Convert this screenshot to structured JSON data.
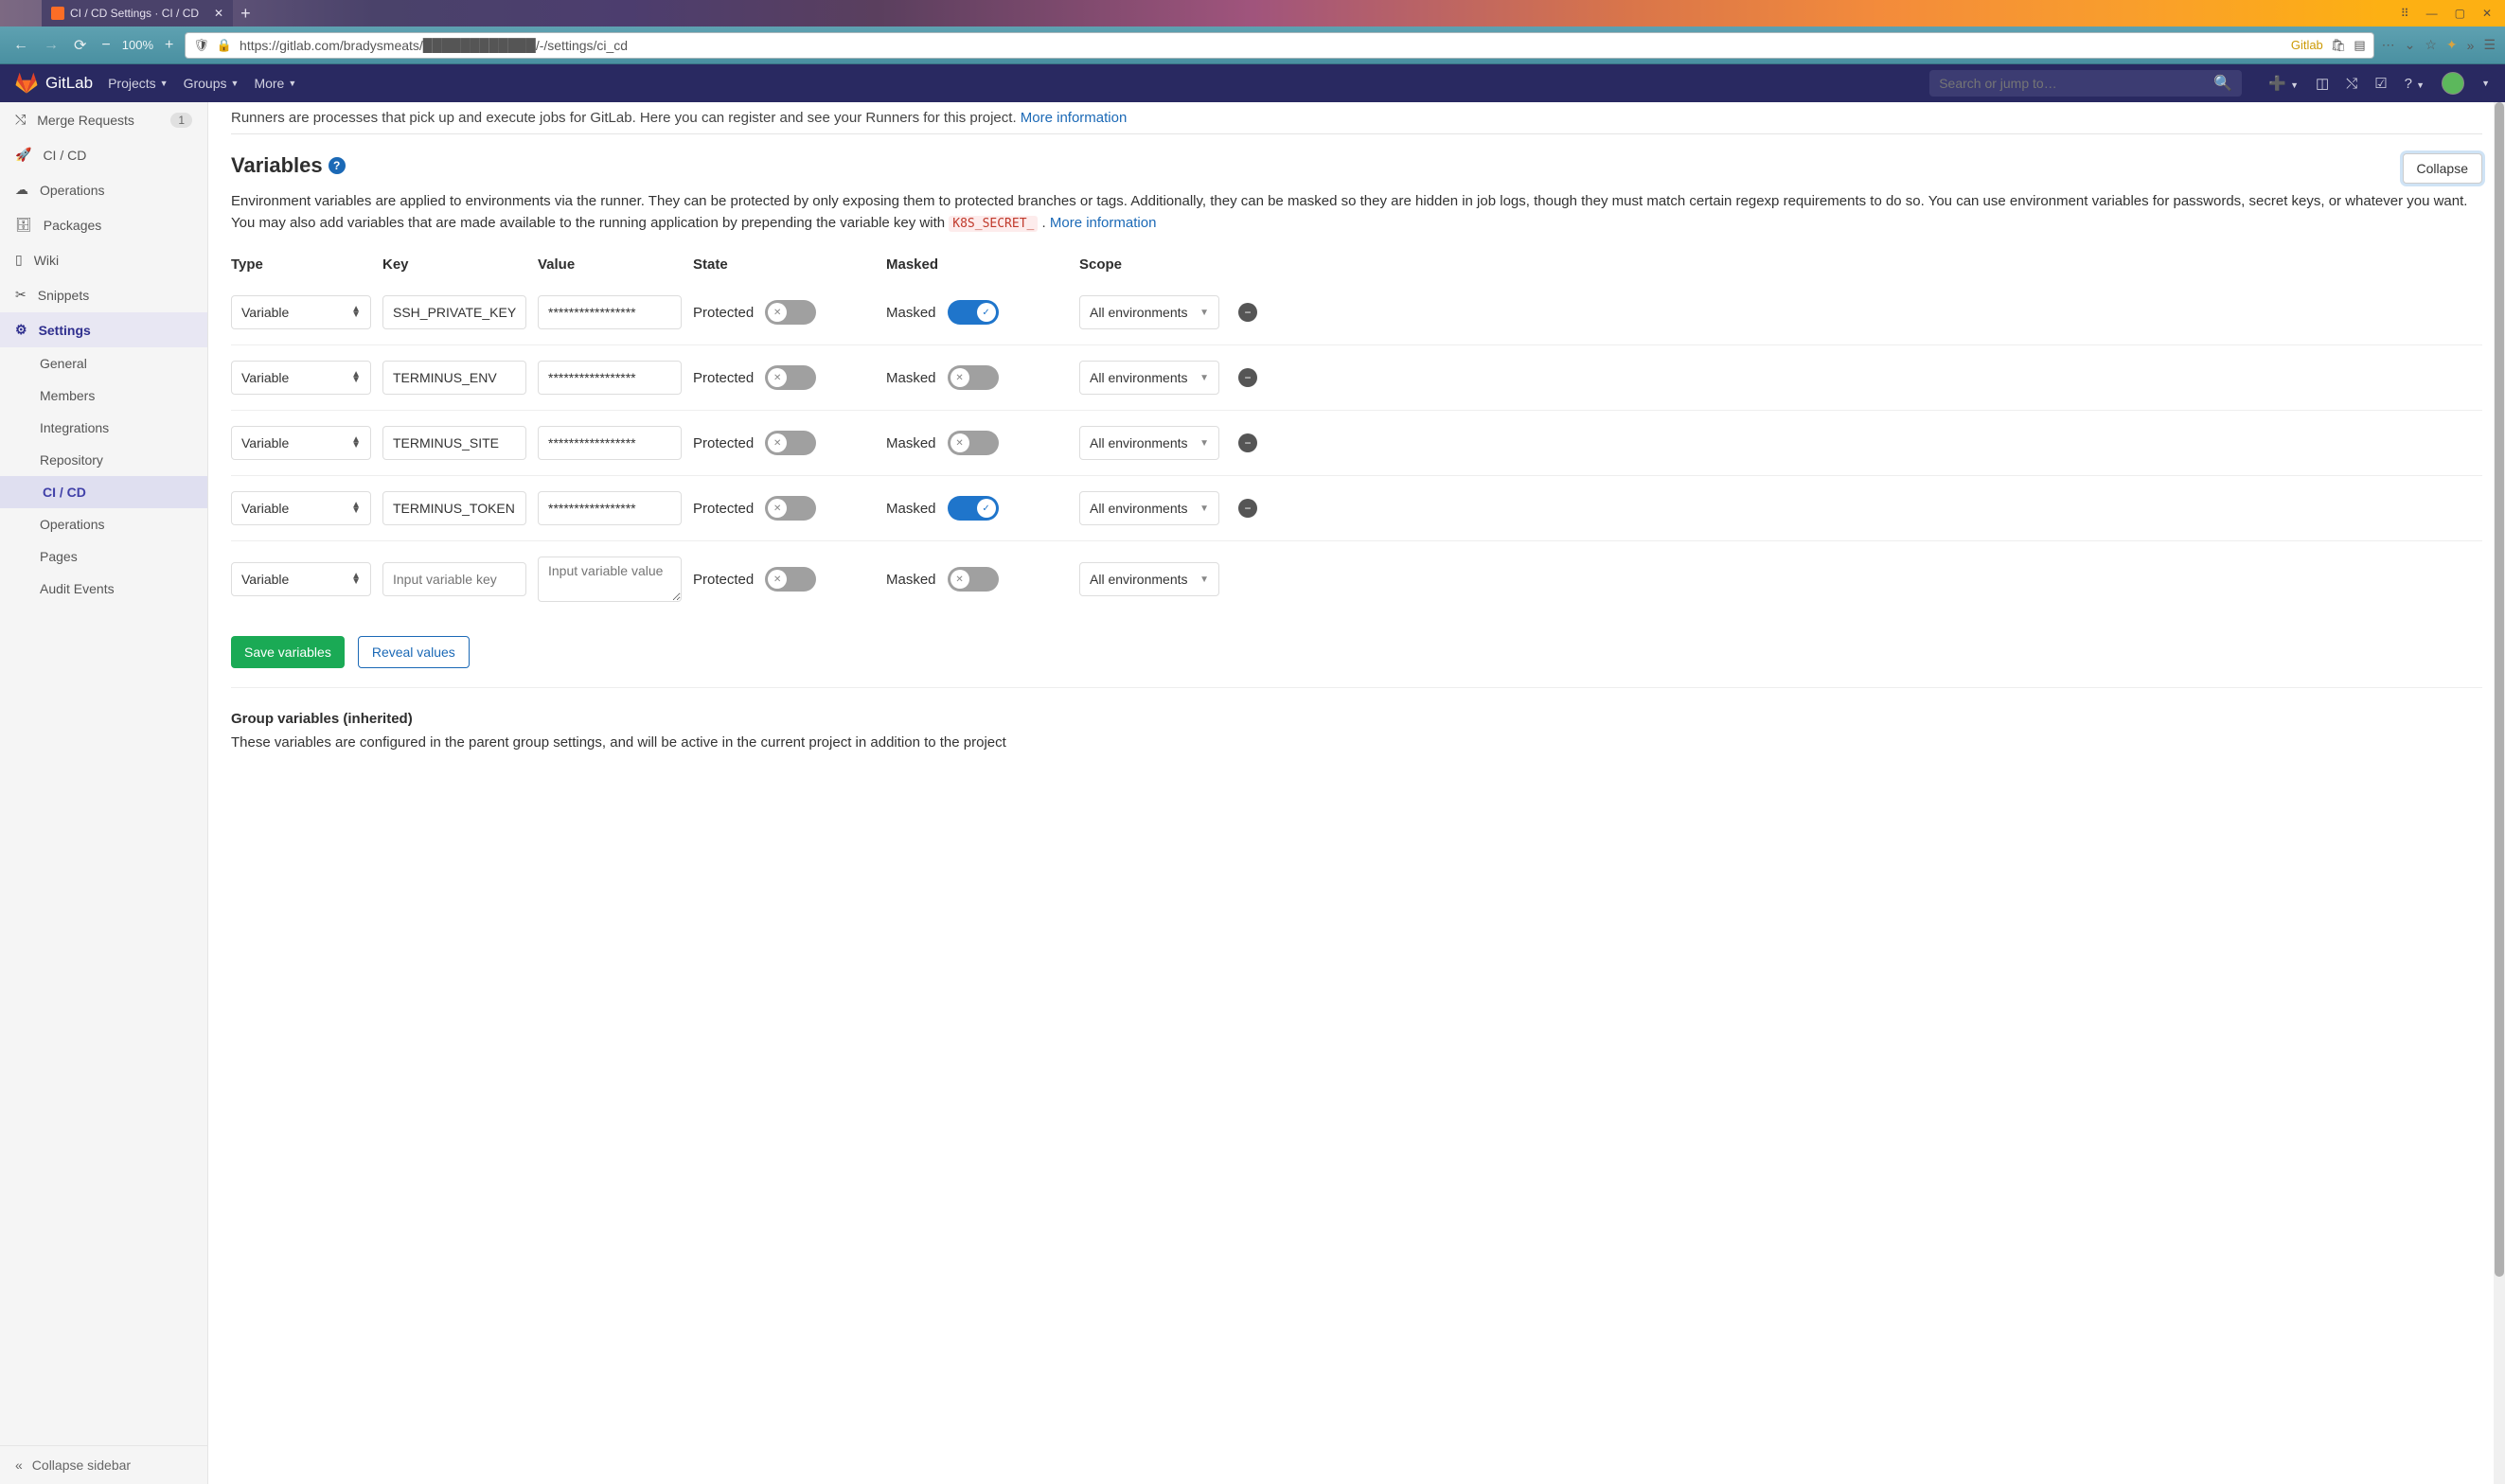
{
  "ubuntu_bar": {
    "tab_title": "CI / CD Settings · CI / CD"
  },
  "browser": {
    "zoom": "100%",
    "url": "https://gitlab.com/bradysmeats/████████████/-/settings/ci_cd",
    "gitlab_label": "Gitlab"
  },
  "nav": {
    "brand": "GitLab",
    "items": [
      "Projects",
      "Groups",
      "More"
    ],
    "search_placeholder": "Search or jump to…"
  },
  "sidebar": {
    "top": [
      {
        "icon": "merge-request-icon",
        "label": "Merge Requests",
        "badge": "1"
      },
      {
        "icon": "rocket-icon",
        "label": "CI / CD"
      },
      {
        "icon": "cloud-icon",
        "label": "Operations"
      },
      {
        "icon": "package-icon",
        "label": "Packages"
      },
      {
        "icon": "book-icon",
        "label": "Wiki"
      },
      {
        "icon": "scissors-icon",
        "label": "Snippets"
      },
      {
        "icon": "gear-icon",
        "label": "Settings",
        "active": true
      }
    ],
    "sub": [
      {
        "label": "General"
      },
      {
        "label": "Members"
      },
      {
        "label": "Integrations"
      },
      {
        "label": "Repository"
      },
      {
        "label": "CI / CD",
        "active": true
      },
      {
        "label": "Operations"
      },
      {
        "label": "Pages"
      },
      {
        "label": "Audit Events"
      }
    ],
    "footer": "Collapse sidebar"
  },
  "content": {
    "runners_fragment": "Runners are processes that pick up and execute jobs for GitLab. Here you can register and see your Runners for this project.",
    "more_info": "More information",
    "variables_title": "Variables",
    "collapse_btn": "Collapse",
    "variables_desc_1": "Environment variables are applied to environments via the runner. They can be protected by only exposing them to protected branches or tags. Additionally, they can be masked so they are hidden in job logs, though they must match certain regexp requirements to do so. You can use environment variables for passwords, secret keys, or whatever you want. You may also add variables that are made available to the running application by prepending the variable key with ",
    "code": "K8S_SECRET_",
    "variables_desc_2": ". ",
    "headers": {
      "type": "Type",
      "key": "Key",
      "value": "Value",
      "state": "State",
      "masked": "Masked",
      "scope": "Scope"
    },
    "type_option": "Variable",
    "state_label": "Protected",
    "masked_label": "Masked",
    "scope_option": "All environments",
    "key_placeholder": "Input variable key",
    "value_placeholder": "Input variable value",
    "rows": [
      {
        "key": "SSH_PRIVATE_KEY",
        "value": "*****************",
        "masked": true
      },
      {
        "key": "TERMINUS_ENV",
        "value": "*****************",
        "masked": false
      },
      {
        "key": "TERMINUS_SITE",
        "value": "*****************",
        "masked": false
      },
      {
        "key": "TERMINUS_TOKEN",
        "value": "*****************",
        "masked": true
      }
    ],
    "save_btn": "Save variables",
    "reveal_btn": "Reveal values",
    "group_title": "Group variables (inherited)",
    "group_desc": "These variables are configured in the parent group settings, and will be active in the current project in addition to the project"
  }
}
